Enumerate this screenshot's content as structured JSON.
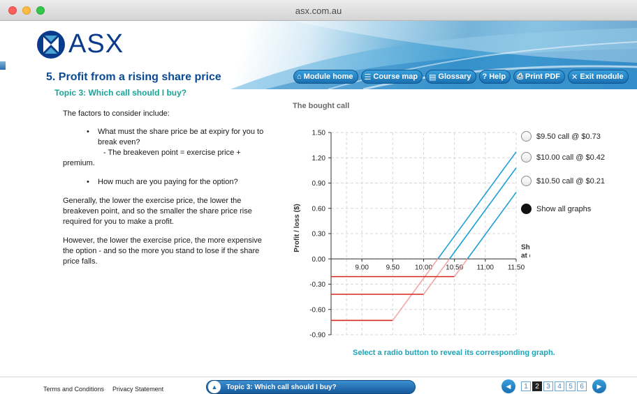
{
  "window": {
    "title": "asx.com.au"
  },
  "logo": {
    "text": "ASX"
  },
  "header": {
    "page_title": "5. Profit from a rising share price",
    "topic_title": "Topic 3: Which call should I buy?"
  },
  "nav": [
    {
      "label": "Module home",
      "icon": "house-icon",
      "glyph": "⌂"
    },
    {
      "label": "Course map",
      "icon": "map-icon",
      "glyph": "☰"
    },
    {
      "label": "Glossary",
      "icon": "book-icon",
      "glyph": "▤"
    },
    {
      "label": "Help",
      "icon": "question-icon",
      "glyph": "?"
    },
    {
      "label": "Print PDF",
      "icon": "printer-icon",
      "glyph": "⎙"
    },
    {
      "label": "Exit module",
      "icon": "close-icon",
      "glyph": "✕"
    }
  ],
  "content": {
    "intro": "The factors to consider include:",
    "bullet1_line1": "What must the share price be at expiry for you to",
    "bullet1_line2": "break even?",
    "sub_line1": "- The breakeven point = exercise price +",
    "sub_line2": "premium.",
    "bullet2": "How much are you paying for the option?",
    "para1": "Generally, the lower the exercise price, the lower the breakeven point, and so the smaller the share price rise required for you to make a profit.",
    "para2": "However, the lower the exercise price, the more expensive the option - and so the more you stand to lose if the share price falls."
  },
  "chart_data": {
    "type": "line",
    "title": "The bought call",
    "xlabel": "Share price at expiry ($)",
    "ylabel": "Profit / loss ($)",
    "xlim": [
      8.5,
      11.5
    ],
    "ylim": [
      -0.9,
      1.5
    ],
    "x_ticks": [
      "9.00",
      "9.50",
      "10.00",
      "10.50",
      "11.00",
      "11.50"
    ],
    "y_ticks": [
      "1.50",
      "1.20",
      "0.90",
      "0.60",
      "0.30",
      "0.00",
      "-0.30",
      "-0.60",
      "-0.90"
    ],
    "grid": true,
    "series": [
      {
        "name": "$9.50 call @ $0.73",
        "strike": 9.5,
        "premium": 0.73,
        "loss_points": [
          [
            8.5,
            -0.73
          ],
          [
            9.5,
            -0.73
          ]
        ],
        "ramp_points": [
          [
            9.5,
            -0.73
          ],
          [
            10.23,
            0.0
          ]
        ],
        "profit_points": [
          [
            10.23,
            0.0
          ],
          [
            11.5,
            1.27
          ]
        ]
      },
      {
        "name": "$10.00 call @ $0.42",
        "strike": 10.0,
        "premium": 0.42,
        "loss_points": [
          [
            8.5,
            -0.42
          ],
          [
            10.0,
            -0.42
          ]
        ],
        "ramp_points": [
          [
            10.0,
            -0.42
          ],
          [
            10.42,
            0.0
          ]
        ],
        "profit_points": [
          [
            10.42,
            0.0
          ],
          [
            11.5,
            1.08
          ]
        ]
      },
      {
        "name": "$10.50 call @ $0.21",
        "strike": 10.5,
        "premium": 0.21,
        "loss_points": [
          [
            8.5,
            -0.21
          ],
          [
            10.5,
            -0.21
          ]
        ],
        "ramp_points": [
          [
            10.5,
            -0.21
          ],
          [
            10.71,
            0.0
          ]
        ],
        "profit_points": [
          [
            10.71,
            0.0
          ],
          [
            11.5,
            0.79
          ]
        ]
      }
    ],
    "colors": {
      "profit": "#1aa0d6",
      "loss": "#d9261c",
      "ramp": "#f4a6a6"
    }
  },
  "options": [
    {
      "label": "$9.50 call @ $0.73",
      "checked": false
    },
    {
      "label": "$10.00 call @ $0.42",
      "checked": false
    },
    {
      "label": "$10.50 call @ $0.21",
      "checked": false
    },
    {
      "label": "Show all graphs",
      "checked": true
    }
  ],
  "hint": "Select a radio button to reveal its corresponding graph.",
  "footer": {
    "terms": "Terms and Conditions",
    "privacy": "Privacy Statement",
    "topic_bar": "Topic 3: Which call should I buy?",
    "pages": [
      "1",
      "2",
      "3",
      "4",
      "5",
      "6"
    ],
    "current_page": "2"
  }
}
